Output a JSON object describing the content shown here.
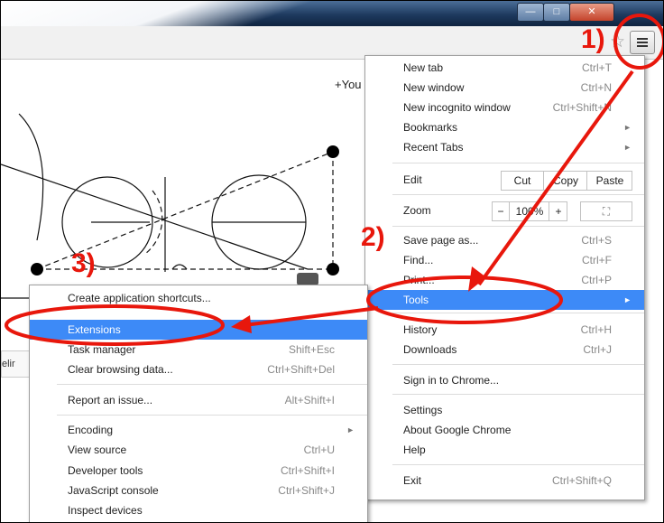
{
  "window": {
    "min_glyph": "—",
    "max_glyph": "□",
    "close_glyph": "✕"
  },
  "toolbar": {
    "star_icon": "star-icon",
    "menu_icon": "hamburger-icon"
  },
  "page": {
    "plus_you": "+You",
    "strip_text": "elir"
  },
  "main_menu": {
    "new_tab": {
      "label": "New tab",
      "shortcut": "Ctrl+T"
    },
    "new_window": {
      "label": "New window",
      "shortcut": "Ctrl+N"
    },
    "new_incognito": {
      "label": "New incognito window",
      "shortcut": "Ctrl+Shift+N"
    },
    "bookmarks": {
      "label": "Bookmarks"
    },
    "recent_tabs": {
      "label": "Recent Tabs"
    },
    "edit": {
      "label": "Edit",
      "cut": "Cut",
      "copy": "Copy",
      "paste": "Paste"
    },
    "zoom": {
      "label": "Zoom",
      "minus": "−",
      "value": "100%",
      "plus": "+"
    },
    "save_page": {
      "label": "Save page as...",
      "shortcut": "Ctrl+S"
    },
    "find": {
      "label": "Find...",
      "shortcut": "Ctrl+F"
    },
    "print": {
      "label": "Print...",
      "shortcut": "Ctrl+P"
    },
    "tools": {
      "label": "Tools"
    },
    "history": {
      "label": "History",
      "shortcut": "Ctrl+H"
    },
    "downloads": {
      "label": "Downloads",
      "shortcut": "Ctrl+J"
    },
    "sign_in": {
      "label": "Sign in to Chrome..."
    },
    "settings": {
      "label": "Settings"
    },
    "about": {
      "label": "About Google Chrome"
    },
    "help": {
      "label": "Help"
    },
    "exit": {
      "label": "Exit",
      "shortcut": "Ctrl+Shift+Q"
    }
  },
  "tools_menu": {
    "create_shortcuts": {
      "label": "Create application shortcuts..."
    },
    "extensions": {
      "label": "Extensions"
    },
    "task_manager": {
      "label": "Task manager",
      "shortcut": "Shift+Esc"
    },
    "clear_browsing": {
      "label": "Clear browsing data...",
      "shortcut": "Ctrl+Shift+Del"
    },
    "report_issue": {
      "label": "Report an issue...",
      "shortcut": "Alt+Shift+I"
    },
    "encoding": {
      "label": "Encoding"
    },
    "view_source": {
      "label": "View source",
      "shortcut": "Ctrl+U"
    },
    "developer_tools": {
      "label": "Developer tools",
      "shortcut": "Ctrl+Shift+I"
    },
    "javascript_console": {
      "label": "JavaScript console",
      "shortcut": "Ctrl+Shift+J"
    },
    "inspect_devices": {
      "label": "Inspect devices"
    }
  },
  "annotations": {
    "step1": "1)",
    "step2": "2)",
    "step3": "3)",
    "color": "#e8170c"
  },
  "colors": {
    "highlight": "#3d8af7",
    "annotation": "#e8170c"
  }
}
